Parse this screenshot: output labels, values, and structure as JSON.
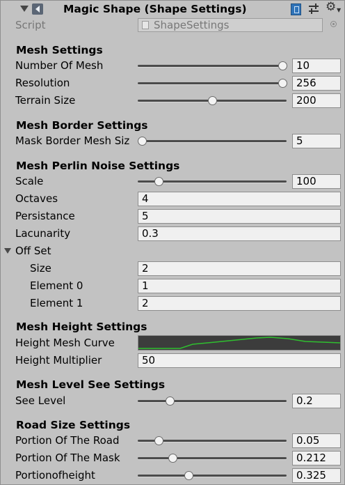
{
  "header": {
    "title": "Magic Shape (Shape Settings)"
  },
  "script_row": {
    "label": "Script",
    "value": "ShapeSettings"
  },
  "mesh_settings": {
    "heading": "Mesh Settings",
    "number_of_mesh": {
      "label": "Number Of Mesh",
      "value": "10",
      "fraction": 1.0
    },
    "resolution": {
      "label": "Resolution",
      "value": "256",
      "fraction": 1.0
    },
    "terrain_size": {
      "label": "Terrain Size",
      "value": "200",
      "fraction": 0.5
    }
  },
  "mesh_border_settings": {
    "heading": "Mesh Border Settings",
    "mask_border_mesh_size": {
      "label": "Mask Border Mesh Siz",
      "value": "5",
      "fraction": 0.0
    }
  },
  "mesh_perlin_noise_settings": {
    "heading": "Mesh Perlin Noise Settings",
    "scale": {
      "label": "Scale",
      "value": "100",
      "fraction": 0.12
    },
    "octaves": {
      "label": "Octaves",
      "value": "4"
    },
    "persistance": {
      "label": "Persistance",
      "value": "5"
    },
    "lacunarity": {
      "label": "Lacunarity",
      "value": "0.3"
    },
    "offset": {
      "label": "Off Set",
      "size": {
        "label": "Size",
        "value": "2"
      },
      "element0": {
        "label": "Element 0",
        "value": "1"
      },
      "element1": {
        "label": "Element 1",
        "value": "2"
      }
    }
  },
  "mesh_height_settings": {
    "heading": "Mesh Height Settings",
    "height_mesh_curve": {
      "label": "Height Mesh Curve",
      "curve_color": "#2fbf2f"
    },
    "height_multiplier": {
      "label": "Height Multiplier",
      "value": "50"
    }
  },
  "mesh_level_see_settings": {
    "heading": "Mesh Level See Settings",
    "see_level": {
      "label": "See Level",
      "value": "0.2",
      "fraction": 0.2
    }
  },
  "road_size_settings": {
    "heading": "Road Size Settings",
    "portion_of_the_road": {
      "label": "Portion Of The Road",
      "value": "0.05",
      "fraction": 0.12
    },
    "portion_of_the_mask": {
      "label": "Portion Of The Mask",
      "value": "0.212",
      "fraction": 0.22
    },
    "portionofheight": {
      "label": "Portionofheight",
      "value": "0.325",
      "fraction": 0.33
    }
  },
  "colors": {
    "panel_bg": "#c2c2c2",
    "field_bg": "#f0f0f0",
    "curve_bg": "#3c3c3c"
  }
}
